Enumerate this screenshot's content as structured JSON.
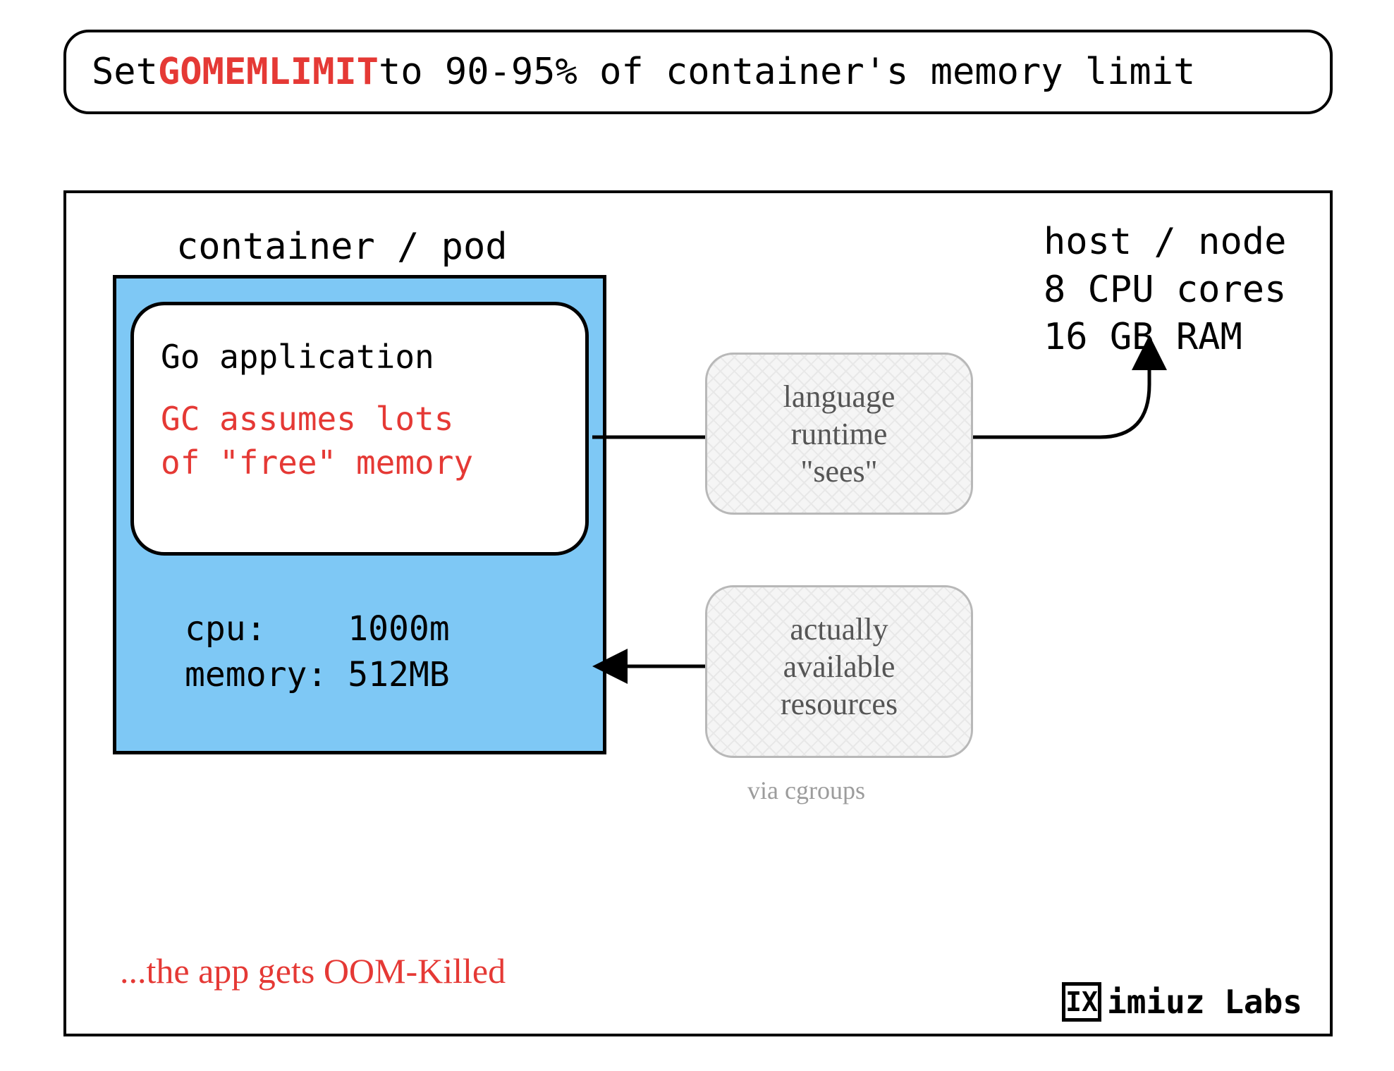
{
  "header": {
    "prefix": "Set ",
    "keyword": "GOMEMLIMIT",
    "suffix": " to 90-95% of container's memory limit"
  },
  "diagram": {
    "container_label": "container / pod",
    "app": {
      "title": "Go application",
      "note_line1": "GC assumes lots",
      "note_line2": "of \"free\" memory"
    },
    "limits": {
      "cpu_label": "cpu:",
      "cpu_value": "1000m",
      "mem_label": "memory:",
      "mem_value": "512MB"
    },
    "oom_note": "...the app gets OOM-Killed",
    "host": {
      "label": "host / node",
      "cpu": "8 CPU cores",
      "ram": "16 GB RAM"
    },
    "callouts": {
      "sees_line1": "language",
      "sees_line2": "runtime",
      "sees_line3": "\"sees\"",
      "avail_line1": "actually",
      "avail_line2": "available",
      "avail_line3": "resources",
      "cgroups": "via cgroups"
    }
  },
  "logo": {
    "mark": "IX",
    "text": "imiuz Labs"
  }
}
